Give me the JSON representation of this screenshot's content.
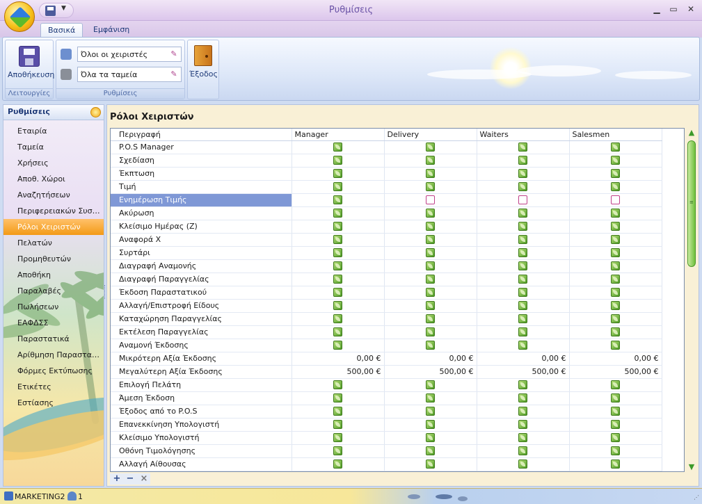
{
  "window": {
    "title": "Ρυθμίσεις"
  },
  "ribbon": {
    "tabs": [
      {
        "label": "Βασικά",
        "active": true
      },
      {
        "label": "Εμφάνιση",
        "active": false
      }
    ],
    "groups": {
      "actions": {
        "label": "Λειτουργίες",
        "save_label": "Αποθήκευση"
      },
      "settings": {
        "label": "Ρυθμίσεις",
        "operators_combo": "Όλοι οι χειριστές",
        "registers_combo": "Όλα τα ταμεία"
      },
      "exit": {
        "label": "Έξοδος"
      }
    }
  },
  "sidebar": {
    "header": "Ρυθμίσεις",
    "items": [
      {
        "label": "Εταιρία"
      },
      {
        "label": "Ταμεία"
      },
      {
        "label": "Χρήσεις"
      },
      {
        "label": "Αποθ. Χώροι"
      },
      {
        "label": "Αναζητήσεων"
      },
      {
        "label": "Περιφερειακών Συστημάτων"
      },
      {
        "label": "Ρόλοι Χειριστών",
        "active": true
      },
      {
        "label": "Πελατών"
      },
      {
        "label": "Προμηθευτών"
      },
      {
        "label": "Αποθήκη"
      },
      {
        "label": "Παραλαβές"
      },
      {
        "label": "Πωλήσεων"
      },
      {
        "label": "ΕΑΦΔΣΣ"
      },
      {
        "label": "Παραστατικά"
      },
      {
        "label": "Αρίθμηση Παραστατικών"
      },
      {
        "label": "Φόρμες Εκτύπωσης"
      },
      {
        "label": "Ετικέτες"
      },
      {
        "label": "Εστίασης"
      }
    ]
  },
  "main": {
    "title": "Ρόλοι Χειριστών",
    "columns": [
      "Περιγραφή",
      "Manager",
      "Delivery",
      "Waiters",
      "Salesmen"
    ],
    "rows": [
      {
        "label": "P.O.S Manager",
        "type": "check",
        "values": [
          true,
          true,
          true,
          true
        ]
      },
      {
        "label": "Σχεδίαση",
        "type": "check",
        "values": [
          true,
          true,
          true,
          true
        ]
      },
      {
        "label": "Έκπτωση",
        "type": "check",
        "values": [
          true,
          true,
          true,
          true
        ]
      },
      {
        "label": "Τιμή",
        "type": "check",
        "values": [
          true,
          true,
          true,
          true
        ]
      },
      {
        "label": "Ενημέρωση Τιμής",
        "type": "check",
        "values": [
          true,
          false,
          false,
          false
        ],
        "selected": true
      },
      {
        "label": "Ακύρωση",
        "type": "check",
        "values": [
          true,
          true,
          true,
          true
        ]
      },
      {
        "label": "Κλείσιμο Ημέρας (Z)",
        "type": "check",
        "values": [
          true,
          true,
          true,
          true
        ]
      },
      {
        "label": "Αναφορά X",
        "type": "check",
        "values": [
          true,
          true,
          true,
          true
        ]
      },
      {
        "label": "Συρτάρι",
        "type": "check",
        "values": [
          true,
          true,
          true,
          true
        ]
      },
      {
        "label": "Διαγραφή Αναμονής",
        "type": "check",
        "values": [
          true,
          true,
          true,
          true
        ]
      },
      {
        "label": "Διαγραφή Παραγγελίας",
        "type": "check",
        "values": [
          true,
          true,
          true,
          true
        ]
      },
      {
        "label": "Έκδοση Παραστατικού",
        "type": "check",
        "values": [
          true,
          true,
          true,
          true
        ]
      },
      {
        "label": "Αλλαγή/Επιστροφή Είδους",
        "type": "check",
        "values": [
          true,
          true,
          true,
          true
        ]
      },
      {
        "label": "Καταχώρηση Παραγγελίας",
        "type": "check",
        "values": [
          true,
          true,
          true,
          true
        ]
      },
      {
        "label": "Εκτέλεση Παραγγελίας",
        "type": "check",
        "values": [
          true,
          true,
          true,
          true
        ]
      },
      {
        "label": "Αναμονή Έκδοσης",
        "type": "check",
        "values": [
          true,
          true,
          true,
          true
        ]
      },
      {
        "label": "Μικρότερη Αξία Έκδοσης",
        "type": "value",
        "values": [
          "0,00 €",
          "0,00 €",
          "0,00 €",
          "0,00 €"
        ]
      },
      {
        "label": "Μεγαλύτερη Αξία Έκδοσης",
        "type": "value",
        "values": [
          "500,00 €",
          "500,00 €",
          "500,00 €",
          "500,00 €"
        ]
      },
      {
        "label": "Επιλογή Πελάτη",
        "type": "check",
        "values": [
          true,
          true,
          true,
          true
        ]
      },
      {
        "label": "Άμεση Έκδοση",
        "type": "check",
        "values": [
          true,
          true,
          true,
          true
        ]
      },
      {
        "label": "Έξοδος από το P.O.S",
        "type": "check",
        "values": [
          true,
          true,
          true,
          true
        ]
      },
      {
        "label": "Επανεκκίνηση Υπολογιστή",
        "type": "check",
        "values": [
          true,
          true,
          true,
          true
        ]
      },
      {
        "label": "Κλείσιμο Υπολογιστή",
        "type": "check",
        "values": [
          true,
          true,
          true,
          true
        ]
      },
      {
        "label": "Οθόνη Τιμολόγησης",
        "type": "check",
        "values": [
          true,
          true,
          true,
          true
        ]
      },
      {
        "label": "Αλλαγή Αίθουσας",
        "type": "check",
        "values": [
          true,
          true,
          true,
          true
        ]
      }
    ],
    "navigator": [
      "+",
      "−",
      "×"
    ]
  },
  "statusbar": {
    "database": "MARKETING2",
    "users": "1"
  },
  "colors": {
    "accent": "#f39a16",
    "selection": "#7f98d6",
    "check_on": "#4d9a24",
    "check_off_border": "#c0408a",
    "title": "#6a52a6"
  }
}
